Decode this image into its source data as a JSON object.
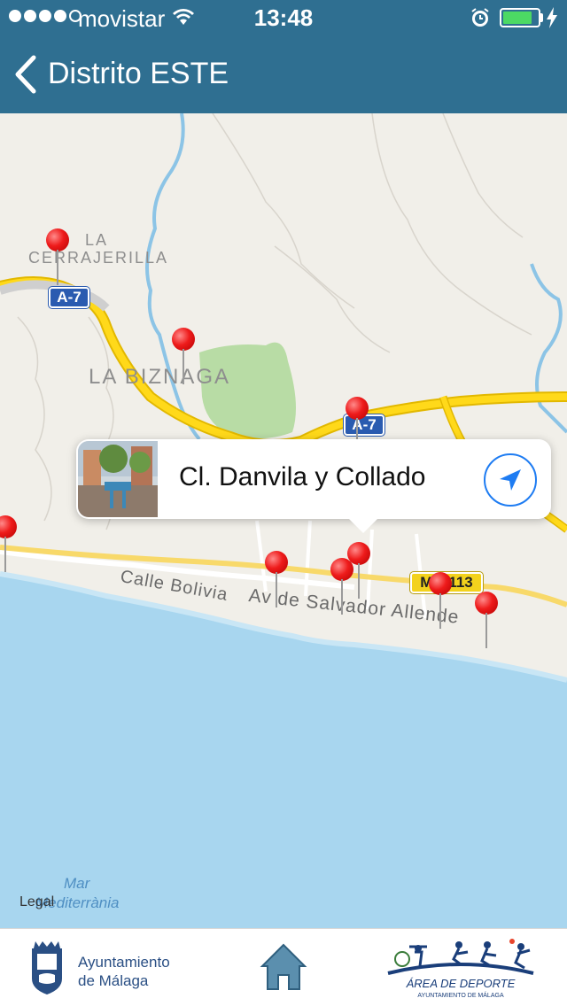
{
  "status_bar": {
    "carrier": "movistar",
    "time": "13:48",
    "signal_bars_filled": 4,
    "signal_bars_total": 5,
    "battery_level": 0.85,
    "battery_color": "#4cd964"
  },
  "nav_bar": {
    "title": "Distrito ESTE",
    "back_icon": "chevron-left-icon",
    "background": "#2f6f91"
  },
  "map": {
    "labels": {
      "la_cerrajerilla_1": "LA",
      "la_cerrajerilla_2": "CERRAJERILLA",
      "la_biznaga": "LA BIZNAGA",
      "calle_bolivia": "Calle Bolivia",
      "av_salvador_allende": "Av de Salvador Allende",
      "mar_1": "Mar",
      "mar_2": "Mediterrània"
    },
    "road_shields": {
      "a7_north": "A-7",
      "a7_east": "A-7",
      "ma_113": "MA-113"
    },
    "legal": "Legal",
    "pin_count": 10,
    "pin_color": "#ee1b1b"
  },
  "callout": {
    "title": "Cl. Danvila y Collado",
    "thumbnail": "playground-photo",
    "action_icon": "navigation-arrow-icon",
    "accent": "#1e7cf2"
  },
  "footer": {
    "city_line1": "Ayuntamiento",
    "city_line2": "de Málaga",
    "home_icon": "home-icon",
    "sport_logo_title": "ÁREA DE DEPORTE",
    "sport_logo_subtitle": "AYUNTAMIENTO DE MÁLAGA"
  }
}
